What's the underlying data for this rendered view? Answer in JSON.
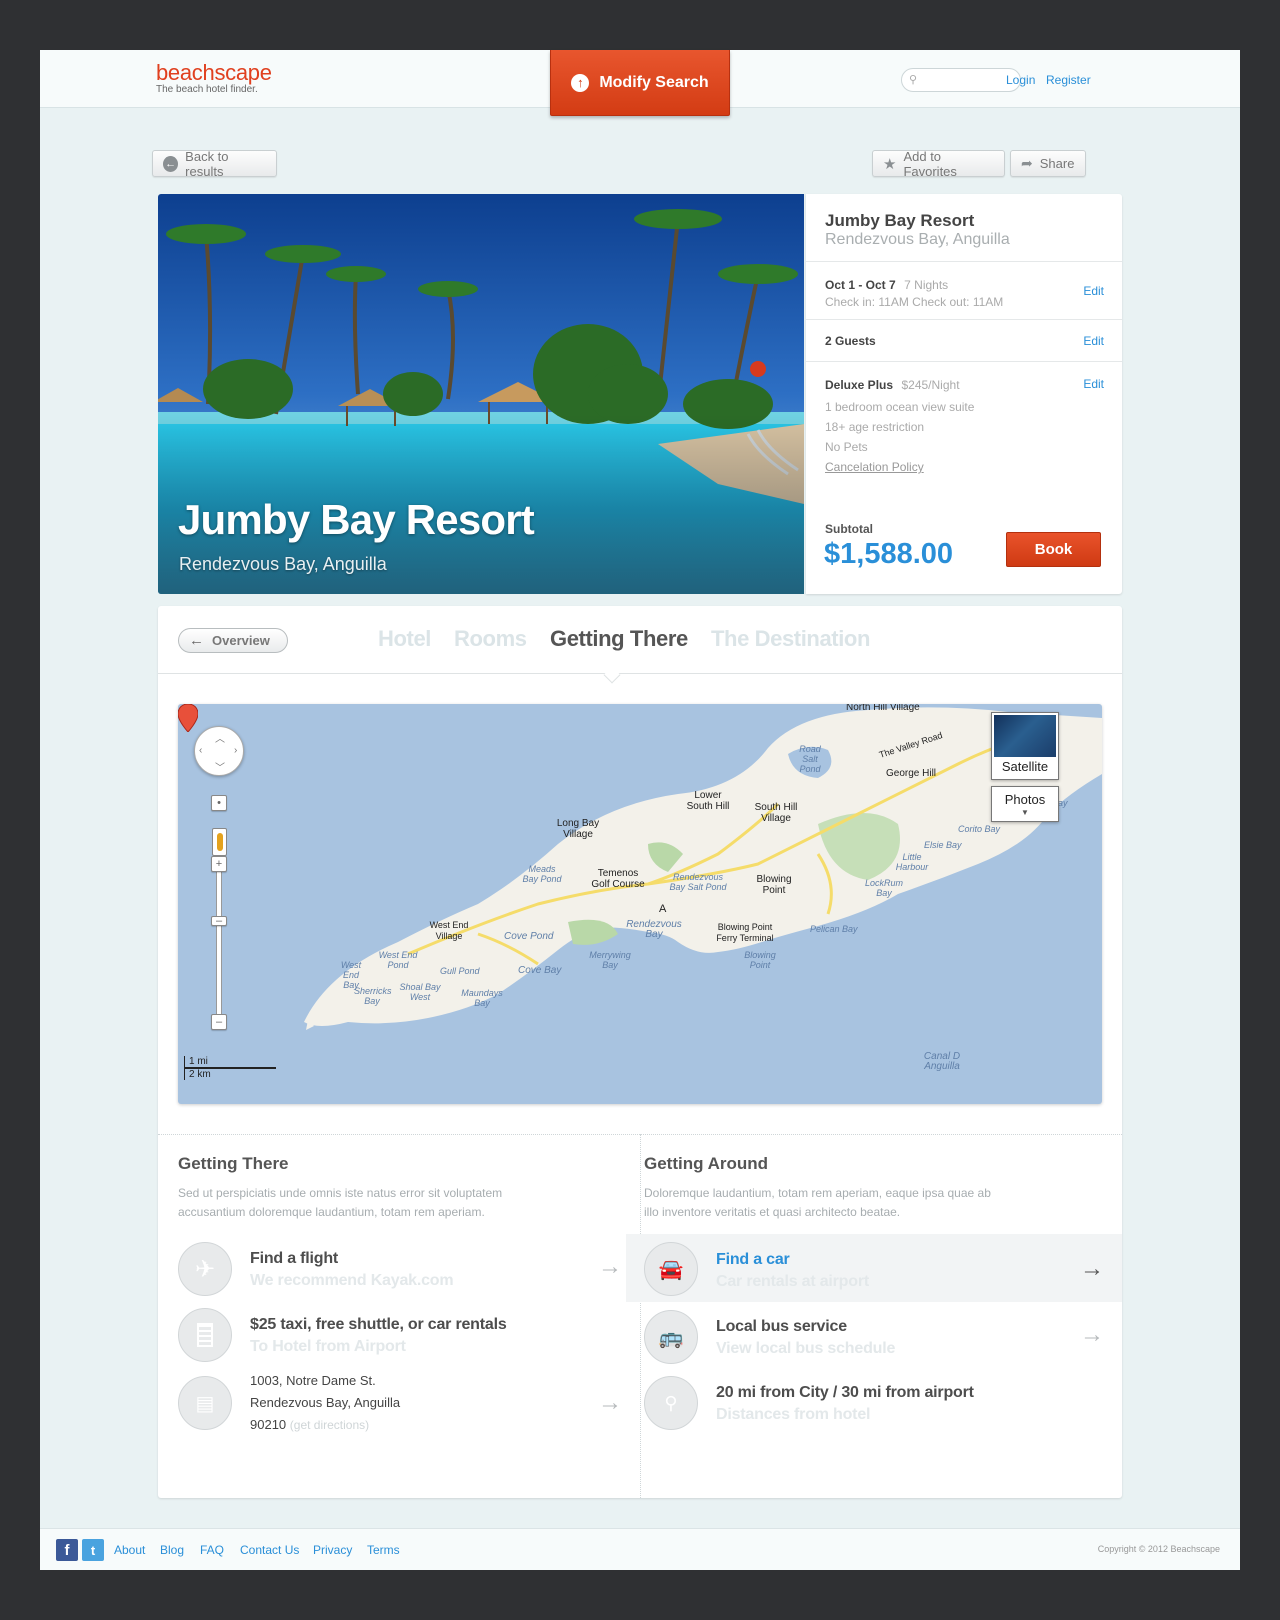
{
  "header": {
    "logo": "beachscape",
    "tagline": "The beach hotel finder.",
    "modify_label": "Modify Search",
    "search_placeholder": "",
    "login": "Login",
    "register": "Register"
  },
  "actions": {
    "back": "Back to results",
    "favorites": "Add to Favorites",
    "share": "Share"
  },
  "hero": {
    "title": "Jumby Bay Resort",
    "subtitle": "Rendezvous Bay, Anguilla"
  },
  "booking": {
    "title": "Jumby Bay Resort",
    "location": "Rendezvous Bay, Anguilla",
    "dates": "Oct 1 - Oct 7",
    "nights": "7 Nights",
    "check": "Check in: 11AM Check out: 11AM",
    "guests": "2 Guests",
    "room": "Deluxe Plus",
    "rate": "$245/Night",
    "details": [
      "1 bedroom ocean view suite",
      "18+ age restriction",
      "No Pets"
    ],
    "cancel_policy": "Cancelation Policy",
    "edit": "Edit",
    "subtotal_label": "Subtotal",
    "subtotal": "$1,588.00",
    "book": "Book"
  },
  "tabs": {
    "overview": "Overview",
    "items": [
      "Hotel",
      "Rooms",
      "Getting There",
      "The Destination"
    ],
    "active": "Getting There"
  },
  "map": {
    "satellite": "Satellite",
    "photos": "Photos",
    "scale_mi": "1 mi",
    "scale_km": "2 km",
    "marker": "A",
    "labels": {
      "north_hill": "North Hill Village",
      "valley_road": "The Valley Road",
      "george_hill": "George Hill",
      "lower_south_hill": "Lower South Hill",
      "south_hill": "South Hill Village",
      "long_bay": "Long Bay Village",
      "temenos": "Temenos Golf Course",
      "blowing_point": "Blowing Point",
      "ferry": "Blowing Point Ferry Terminal",
      "west_end": "West End Village",
      "rendezvous": "Rendezvous Bay"
    },
    "water": {
      "road_salt_pond": "Road Salt Pond",
      "corito": "Corito Bay",
      "elsie": "Elsie Bay",
      "little_harbour": "Little Harbour",
      "lockrum": "LockRum Bay",
      "meads": "Meads Bay Pond",
      "rendezvous_pond": "Rendezvous Bay Salt Pond",
      "cove_pond": "Cove Pond",
      "west_end_pond": "West End Pond",
      "west_end_bay": "West End Bay",
      "gull_pond": "Gull Pond",
      "shoal_bay": "Shoal Bay West",
      "sherricks": "Sherricks Bay",
      "maundays": "Maundays Bay",
      "cove_bay": "Cove Bay",
      "merrywing": "Merrywing Bay",
      "pelican": "Pelican Bay",
      "blowing_point_w": "Blowing Point",
      "canal": "Canal D Anguilla",
      "partial_ay": "ay"
    }
  },
  "getting_there": {
    "title": "Getting There",
    "desc": "Sed ut perspiciatis unde omnis iste natus error sit voluptatem accusantium doloremque laudantium, totam rem aperiam.",
    "rows": [
      {
        "title": "Find a flight",
        "sub": "We recommend Kayak.com"
      },
      {
        "title": "$25 taxi, free shuttle, or car rentals",
        "sub": "To Hotel from Airport"
      }
    ],
    "address": [
      "1003, Notre Dame St.",
      "Rendezvous Bay, Anguilla",
      "90210"
    ],
    "directions": "(get directions)"
  },
  "getting_around": {
    "title": "Getting Around",
    "desc": "Doloremque laudantium, totam rem aperiam, eaque ipsa quae ab illo inventore veritatis et quasi architecto beatae.",
    "rows": [
      {
        "title": "Find a car",
        "sub": "Car rentals at airport"
      },
      {
        "title": "Local bus service",
        "sub": "View local bus schedule"
      },
      {
        "title": "20 mi from City / 30 mi from airport",
        "sub": "Distances from hotel"
      }
    ]
  },
  "footer": {
    "links": [
      "About",
      "Blog",
      "FAQ",
      "Contact Us",
      "Privacy",
      "Terms"
    ],
    "copyright": "Copyright © 2012 Beachscape"
  },
  "colors": {
    "accent": "#2a8fd8",
    "brand": "#e0401f",
    "book": "#d33c14"
  }
}
